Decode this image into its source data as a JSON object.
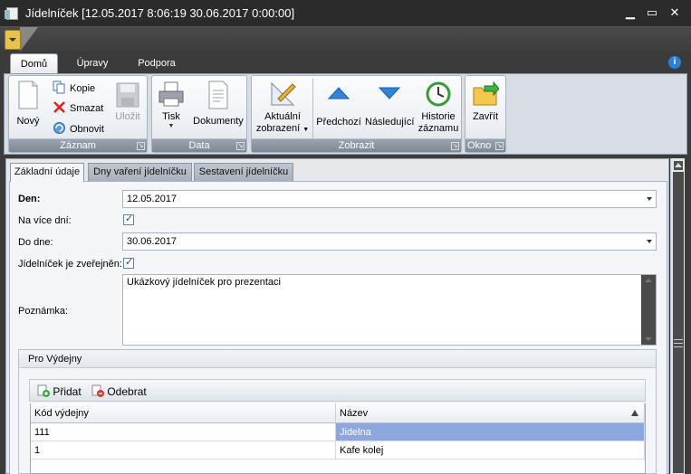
{
  "window": {
    "title": "Jídelníček [12.05.2017 8:06:19 30.06.2017 0:00:00]",
    "minimize": "▁",
    "maximize": "▭",
    "close": "✕"
  },
  "ribbon": {
    "tabs": [
      "Domů",
      "Úpravy",
      "Podpora"
    ],
    "active_tab": "Domů",
    "info_icon": "i",
    "groups": {
      "zaznam": {
        "label": "Záznam",
        "novy": "Nový",
        "kopie": "Kopie",
        "smazat": "Smazat",
        "obnovit": "Obnovit",
        "ulozit": "Uložit"
      },
      "data": {
        "label": "Data",
        "tisk": "Tisk",
        "dokumenty": "Dokumenty"
      },
      "zobrazit": {
        "label": "Zobrazit",
        "aktualni_line1": "Aktuální",
        "aktualni_line2": "zobrazení",
        "predchozi": "Předchozí",
        "nasledujici": "Následující",
        "historie_line1": "Historie",
        "historie_line2": "záznamu"
      },
      "okno": {
        "label": "Okno",
        "zavrit": "Zavřít"
      }
    }
  },
  "content_tabs": [
    "Základní údaje",
    "Dny vaření jídelníčku",
    "Sestavení jídelníčku"
  ],
  "form": {
    "den_label": "Den:",
    "den_value": "12.05.2017",
    "na_vice_dni_label": "Na více dní:",
    "na_vice_dni_checked": true,
    "do_dne_label": "Do dne:",
    "do_dne_value": "30.06.2017",
    "zverejnen_label": "Jídelníček je zveřejněn:",
    "zverejnen_checked": true,
    "poznamka_label": "Poznámka:",
    "poznamka_value": "Ukázkový jídelníček pro prezentaci"
  },
  "vydejny": {
    "title": "Pro Výdejny",
    "pridat": "Přidat",
    "odebrat": "Odebrat",
    "columns": [
      "Kód výdejny",
      "Název"
    ],
    "rows": [
      {
        "kod": "111",
        "nazev": "Jidelna"
      },
      {
        "kod": "1",
        "nazev": "Kafe kolej"
      }
    ]
  },
  "colors": {
    "titlebar": "#2b2b2b",
    "selection": "#8ca6de",
    "ribbon_label": "#7e8895"
  }
}
